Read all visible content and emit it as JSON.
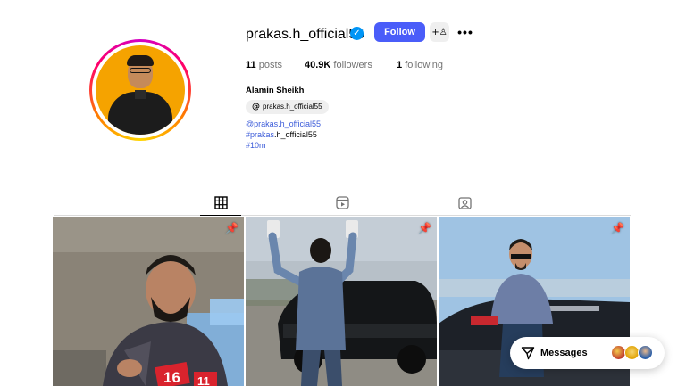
{
  "profile": {
    "username": "prakas.h_official55",
    "follow_label": "Follow",
    "more_label": "•••",
    "suggest_label": "+♙",
    "stats": {
      "posts_count": "11",
      "posts_label": "posts",
      "followers_count": "40.9K",
      "followers_label": "followers",
      "following_count": "1",
      "following_label": "following"
    },
    "full_name": "Alamin Sheikh",
    "threads_handle": "prakas.h_official55",
    "bio": {
      "line1": "@prakas.h_official55",
      "line2_tag": "#prakas",
      "line2_rest": ".h_official55",
      "line3": "#10m"
    }
  },
  "tabs": [
    {
      "name": "posts",
      "icon": "grid-icon",
      "active": true
    },
    {
      "name": "reels",
      "icon": "reels-icon",
      "active": false
    },
    {
      "name": "tagged",
      "icon": "tagged-icon",
      "active": false
    }
  ],
  "posts": [
    {
      "pinned": true,
      "icon": "pin-icon",
      "badge_text": "16",
      "badge_text2": "11"
    },
    {
      "pinned": true,
      "icon": "pin-icon"
    },
    {
      "pinned": true,
      "icon": "pin-icon"
    }
  ],
  "messages": {
    "label": "Messages",
    "icon": "send-icon"
  },
  "colors": {
    "accent": "#4a5df9",
    "link": "#3b5bd9",
    "verified": "#0095f6",
    "avatar_bg": "#f5a300"
  }
}
